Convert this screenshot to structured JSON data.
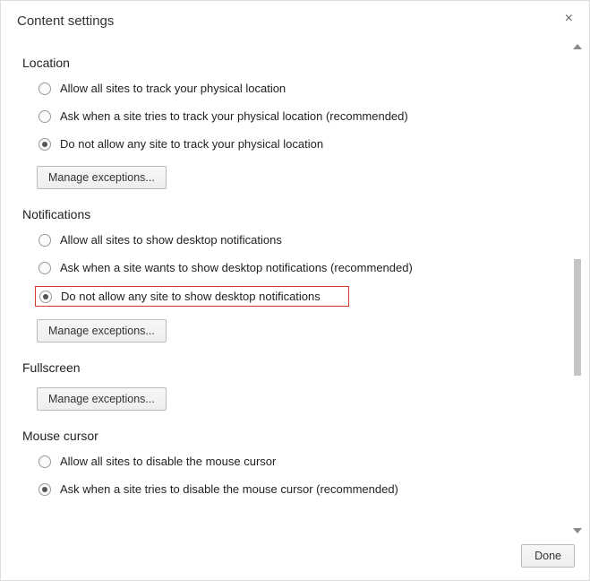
{
  "dialog": {
    "title": "Content settings",
    "close_glyph": "×",
    "done_label": "Done"
  },
  "sections": {
    "location": {
      "title": "Location",
      "opts": [
        "Allow all sites to track your physical location",
        "Ask when a site tries to track your physical location (recommended)",
        "Do not allow any site to track your physical location"
      ],
      "btn": "Manage exceptions..."
    },
    "notifications": {
      "title": "Notifications",
      "opts": [
        "Allow all sites to show desktop notifications",
        "Ask when a site wants to show desktop notifications (recommended)",
        "Do not allow any site to show desktop notifications"
      ],
      "btn": "Manage exceptions..."
    },
    "fullscreen": {
      "title": "Fullscreen",
      "btn": "Manage exceptions..."
    },
    "mouse": {
      "title": "Mouse cursor",
      "opts": [
        "Allow all sites to disable the mouse cursor",
        "Ask when a site tries to disable the mouse cursor (recommended)"
      ]
    }
  }
}
